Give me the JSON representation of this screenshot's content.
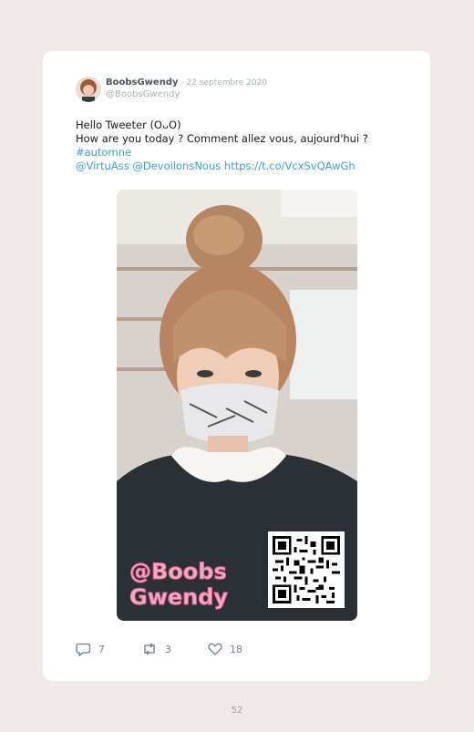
{
  "tweet": {
    "display_name": "BoobsGwendy",
    "date": "· 22 septembre 2020",
    "handle": "@BoobsGwendy",
    "text_line_1": "Hello Tweeter (OᴗO)",
    "text_line_2": "How are you today ? Comment allez vous, aujourd'hui ?",
    "hashtag": "#automne",
    "mention_1": "@VirtuAss",
    "mention_2": "@DevoilonsNous",
    "url": "https://t.co/VcxSvQAwGh",
    "photo_watermark": "@Boobs Gwendy"
  },
  "actions": {
    "reply_count": "7",
    "retweet_count": "3",
    "like_count": "18"
  },
  "page_number": "52",
  "colors": {
    "background": "#efe9e7",
    "card": "#ffffff",
    "link": "#3ea0d8",
    "watermark_pink": "#f7a9c4"
  }
}
